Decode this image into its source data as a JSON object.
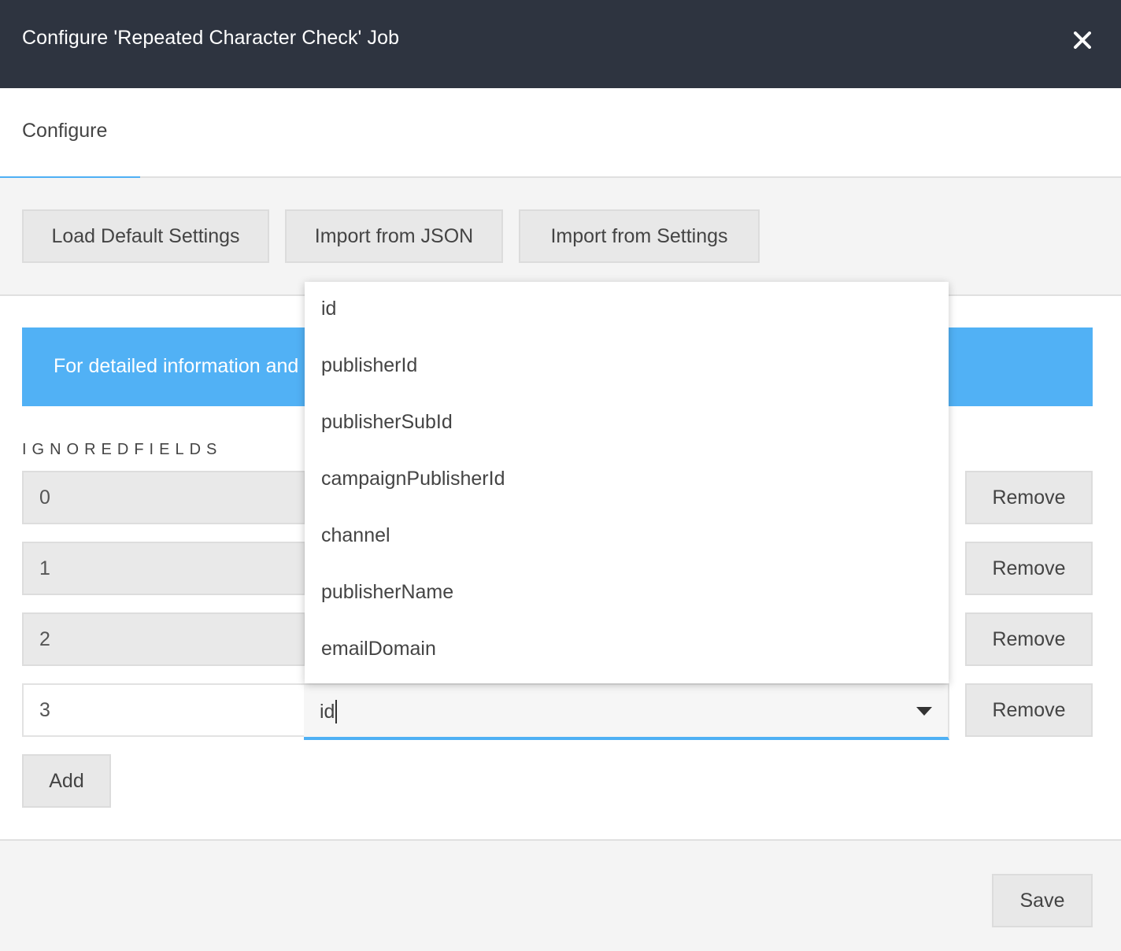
{
  "dialog": {
    "title": "Configure 'Repeated Character Check' Job",
    "close_icon": "close-icon"
  },
  "tabs": [
    {
      "label": "Configure",
      "active": true
    }
  ],
  "toolbar": {
    "load_default": "Load Default Settings",
    "import_json": "Import from JSON",
    "import_settings": "Import from Settings"
  },
  "info_banner": {
    "text": "For detailed information and"
  },
  "ignored_fields": {
    "label": "IGNOREDFIELDS",
    "rows": [
      {
        "index": "0",
        "remove_label": "Remove"
      },
      {
        "index": "1",
        "remove_label": "Remove"
      },
      {
        "index": "2",
        "remove_label": "Remove"
      },
      {
        "index": "3",
        "remove_label": "Remove",
        "value": "id"
      }
    ],
    "add_label": "Add"
  },
  "dropdown": {
    "options": [
      "id",
      "publisherId",
      "publisherSubId",
      "campaignPublisherId",
      "channel",
      "publisherName",
      "emailDomain"
    ]
  },
  "footer": {
    "save_label": "Save"
  },
  "colors": {
    "header_bg": "#2e3440",
    "accent": "#4fb0f4",
    "banner": "#51b1f5"
  }
}
